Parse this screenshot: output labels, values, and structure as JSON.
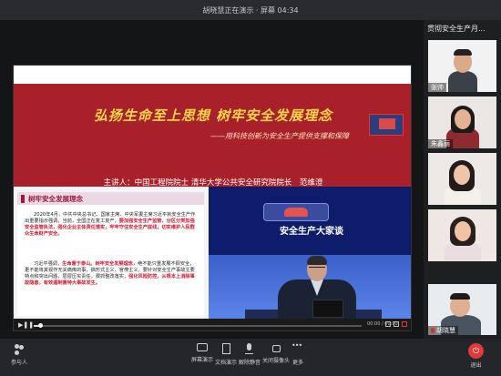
{
  "window": {
    "title": "胡晓慧正在演示 · 屏幕 04:34"
  },
  "slide": {
    "title": "弘扬生命至上思想 树牢安全发展理念",
    "subtitle": "——用科技创新为安全生产提供支撑和保障",
    "speaker": "主讲人：中国工程院院士 清华大学公共安全研究院院长　范维澄",
    "section_heading": "树牢安全发展理念",
    "paragraph1_plain": "2020年4月，中共中央总书记、国家主席、中央军委主席习近平就安全生产作出重要指示强调，当前，全国正在复工复产，",
    "paragraph1_red": "要加强安全生产监管，分区分类加强安全监管执法，强化企业主体责任落实，牢牢守住安全生产底线，切实维护人民群众生命财产安全。",
    "paragraph2_plain": "习近平强调，",
    "paragraph2_red": "生命重于泰山。树牢安全发展理念，",
    "paragraph2_plain2": "绝不能只重发展不顾安全，更不能将其视作无关痛痒的事，搞形式主义、官僚主义。要针对安全生产事故主要特点和突出问题，层层压实责任，狠抓整改落实，",
    "paragraph2_red2": "强化风险防控，从根本上消除事故隐患，有效遏制重特大事故发生。",
    "video_caption": "安全生产大家谈"
  },
  "player": {
    "progress": 0.02,
    "time": "00:00 / 00:00"
  },
  "sidebar": {
    "header": "贯彻安全生产月...",
    "participants": [
      {
        "name": "张帅",
        "muted": false
      },
      {
        "name": "朱鑫丽",
        "muted": false
      },
      {
        "name": "",
        "muted": false
      },
      {
        "name": "",
        "muted": false
      },
      {
        "name": "胡晓慧",
        "muted": true
      }
    ]
  },
  "toolbar": {
    "participants": "参与人",
    "share_screen": "屏幕演示",
    "share_doc": "文档演示",
    "mute": "解除静音",
    "camera": "关闭摄像头",
    "more": "更多",
    "leave": "退出"
  },
  "colors": {
    "slide_red": "#a8202a",
    "title_gold": "#ffd54a",
    "leave_red": "#e03a3a"
  }
}
